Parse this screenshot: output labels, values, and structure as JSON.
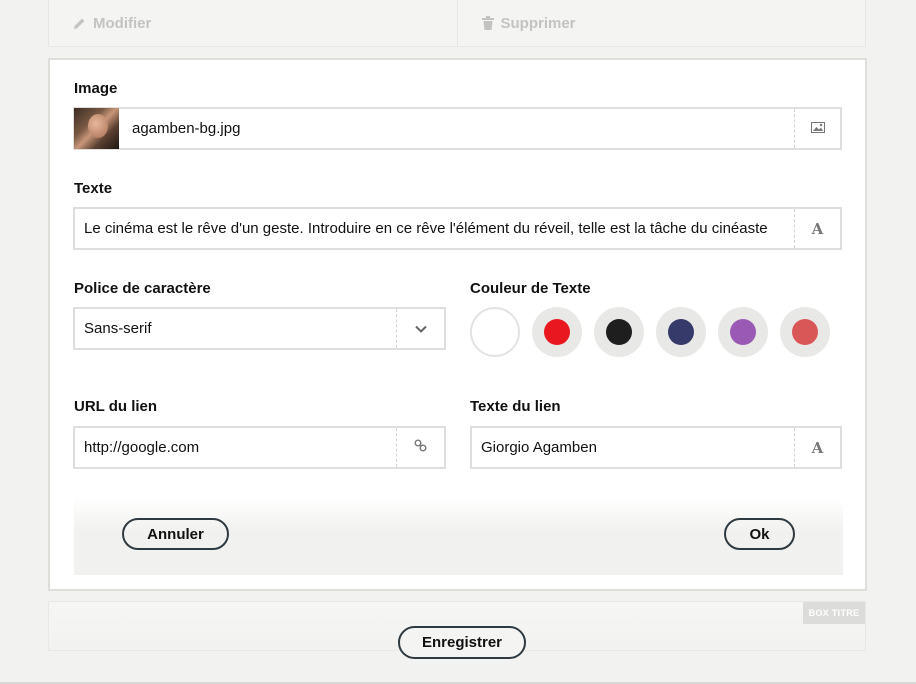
{
  "top_actions": {
    "edit_label": "Modifier",
    "delete_label": "Supprimer"
  },
  "form": {
    "image": {
      "label": "Image",
      "filename": "agamben-bg.jpg",
      "icon": "image-icon"
    },
    "text": {
      "label": "Texte",
      "value": "Le cinéma est le rêve d'un geste. Introduire en ce rêve l'élément du réveil, telle est la tâche du cinéaste",
      "icon": "font-icon"
    },
    "font": {
      "label": "Police de caractère",
      "selected": "Sans-serif",
      "icon": "chevron-down-icon"
    },
    "text_color": {
      "label": "Couleur de Texte",
      "options": [
        "#ffffff",
        "#e8181e",
        "#1e1e1e",
        "#363a6a",
        "#9b59b6",
        "#d95757"
      ],
      "selected_index": 0
    },
    "link_url": {
      "label": "URL du lien",
      "value": "http://google.com",
      "icon": "link-icon"
    },
    "link_text": {
      "label": "Texte du lien",
      "value": "Giorgio Agamben",
      "icon": "font-icon"
    },
    "buttons": {
      "cancel": "Annuler",
      "ok": "Ok"
    }
  },
  "bottom": {
    "box_title": "BOX TITRE",
    "save": "Enregistrer"
  }
}
